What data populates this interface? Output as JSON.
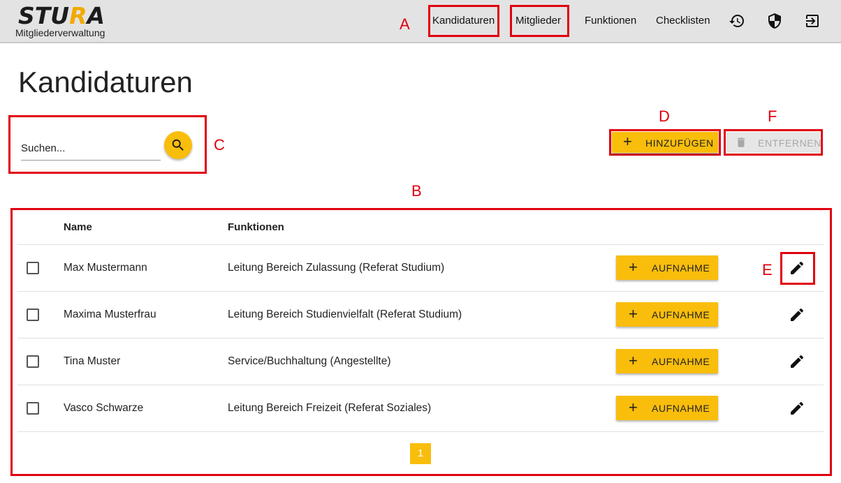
{
  "header": {
    "logo_text": "STURA",
    "logo_subtitle": "Mitgliederverwaltung",
    "nav": [
      {
        "label": "Kandidaturen"
      },
      {
        "label": "Mitglieder"
      },
      {
        "label": "Funktionen"
      },
      {
        "label": "Checklisten"
      }
    ],
    "icons": [
      "history-icon",
      "shield-icon",
      "logout-icon"
    ]
  },
  "page": {
    "title": "Kandidaturen"
  },
  "search": {
    "placeholder": "Suchen..."
  },
  "actions": {
    "add_label": "HINZUFÜGEN",
    "remove_label": "ENTFERNEN"
  },
  "table": {
    "columns": [
      "Name",
      "Funktionen"
    ],
    "row_action_label": "AUFNAHME",
    "rows": [
      {
        "name": "Max Mustermann",
        "funktion": "Leitung Bereich Zulassung (Referat Studium)"
      },
      {
        "name": "Maxima Musterfrau",
        "funktion": "Leitung Bereich Studienvielfalt (Referat Studium)"
      },
      {
        "name": "Tina Muster",
        "funktion": "Service/Buchhaltung (Angestellte)"
      },
      {
        "name": "Vasco Schwarze",
        "funktion": "Leitung Bereich Freizeit (Referat Soziales)"
      }
    ]
  },
  "pagination": {
    "current_page": "1"
  },
  "annotations": {
    "A": "A",
    "B": "B",
    "C": "C",
    "D": "D",
    "E": "E",
    "F": "F"
  },
  "colors": {
    "accent": "#f9bd0c",
    "annotation_red": "#e0000f",
    "header_bg": "#e3e3e3"
  }
}
